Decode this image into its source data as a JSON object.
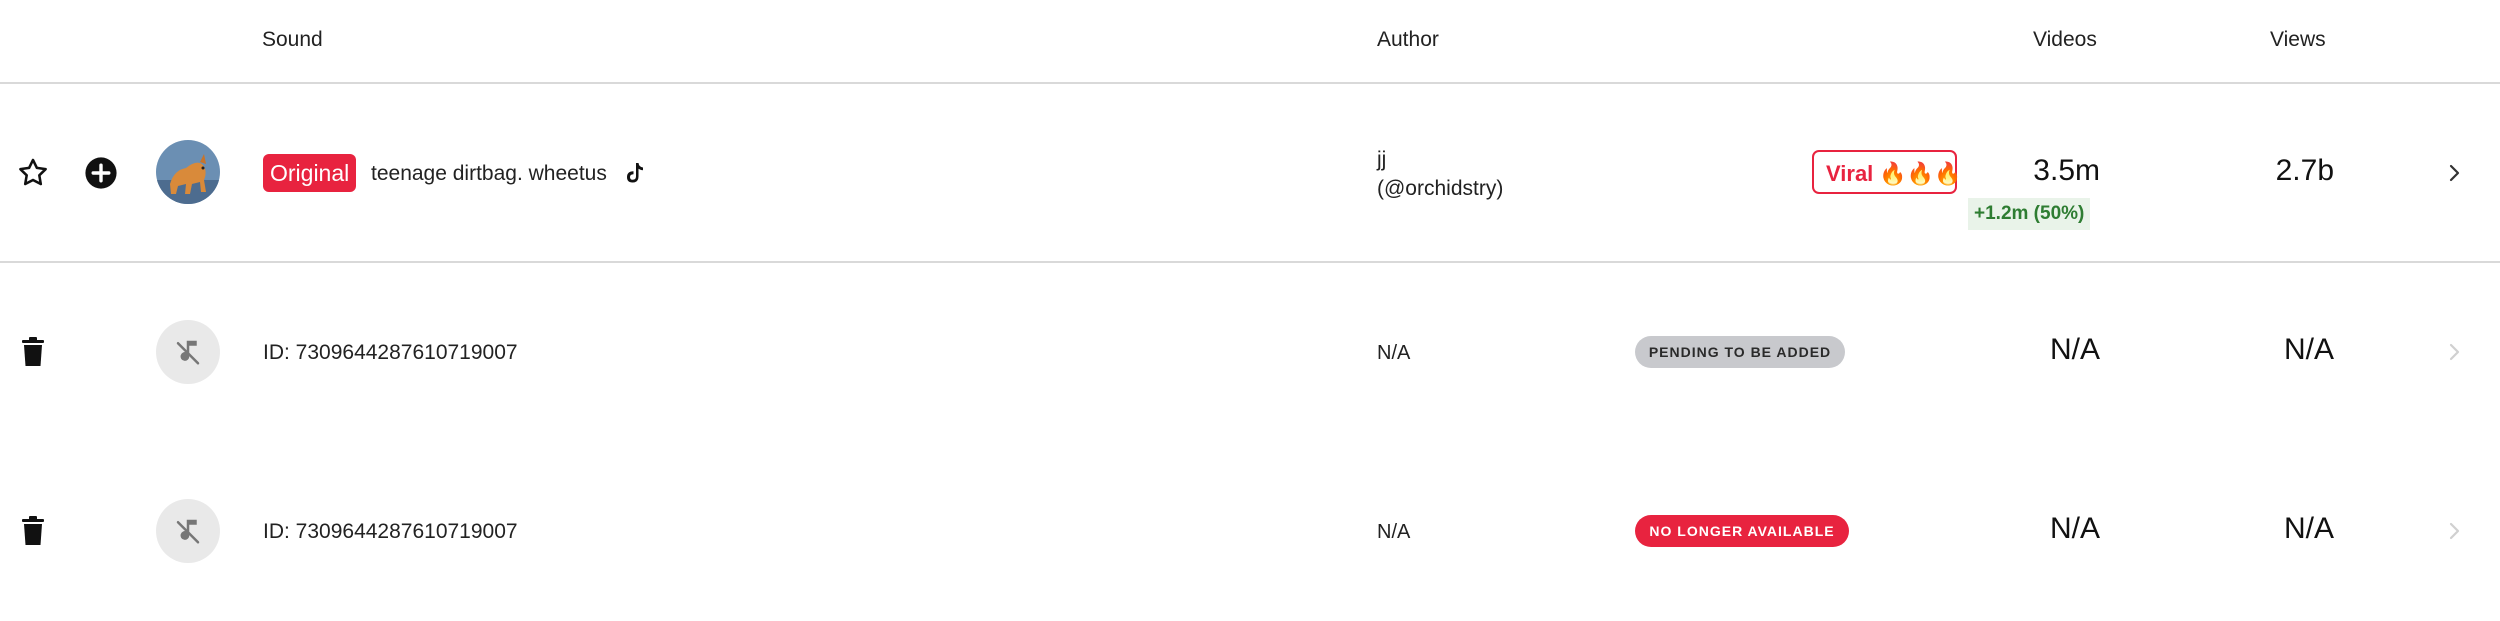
{
  "header": {
    "sound": "Sound",
    "author": "Author",
    "videos": "Videos",
    "views": "Views"
  },
  "rows": [
    {
      "tag": "Original",
      "title": "teenage dirtbag. wheetus",
      "author_name": "jj",
      "author_handle": "(@orchidstry)",
      "badge": "Viral 🔥🔥🔥",
      "videos": "3.5m",
      "videos_growth": "+1.2m (50%)",
      "views": "2.7b",
      "icons": [
        "star-icon",
        "add-circle-icon",
        "tiktok-icon",
        "chevron-right-icon"
      ]
    },
    {
      "id_text": "ID: 7309644287610719007",
      "author": "N/A",
      "status": "PENDING TO BE ADDED",
      "videos": "N/A",
      "views": "N/A",
      "icons": [
        "trash-icon",
        "music-off-icon",
        "chevron-right-icon"
      ]
    },
    {
      "id_text": "ID: 7309644287610719007",
      "author": "N/A",
      "status": "NO LONGER AVAILABLE",
      "videos": "N/A",
      "views": "N/A",
      "icons": [
        "trash-icon",
        "music-off-icon",
        "chevron-right-icon"
      ]
    }
  ],
  "colors": {
    "accent_red": "#e8233f",
    "growth_green": "#2e7d32",
    "growth_bg": "#e9f3e9",
    "pending_gray": "#c8c9cd"
  }
}
